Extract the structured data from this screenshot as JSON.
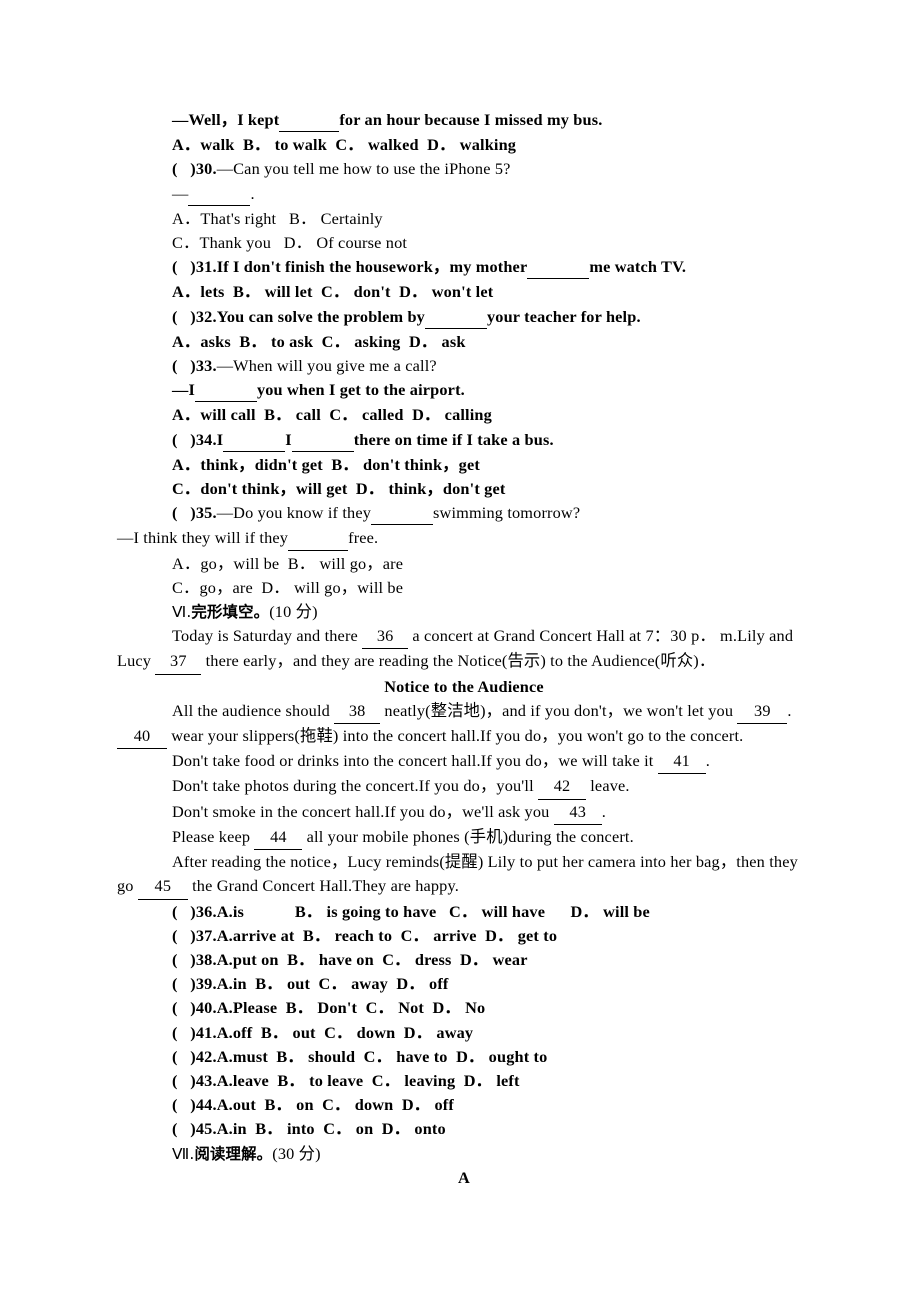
{
  "document": {
    "type": "english-exam-worksheet",
    "page_background": "#ffffff",
    "text_color": "#000000"
  },
  "lines": {
    "q29_stem": "—Well，I kept",
    "q29_stem_tail": "for an hour because I missed my bus.",
    "q29_options": "A．walk  B． to walk  C． walked  D． walking",
    "q30_head": "(   )30.",
    "q30_stem": "—Can you tell me how to use the iPhone 5?",
    "q30_answer_prefix": "—",
    "q30_answer_tail": ".",
    "q30_optionsAB": "A．That's right   B． Certainly",
    "q30_optionsCD": "C．Thank you   D． Of course not",
    "q31_head": "(   )31.",
    "q31_stem_a": "If I don't finish the housework，my mother",
    "q31_stem_b": "me watch TV.",
    "q31_options": "A．lets  B． will let  C． don't  D． won't let",
    "q32_head": "(   )32.",
    "q32_stem_a": "You can solve the problem by",
    "q32_stem_b": "your teacher for help.",
    "q32_options": "A．asks  B． to ask  C． asking  D． ask",
    "q33_head": "(   )33.",
    "q33_stem": "—When will you give me a call?",
    "q33_answer_prefix": "—I",
    "q33_answer_tail": "you when I get to the airport.",
    "q33_options": "A．will call  B． call  C． called  D． calling",
    "q34_head": "(   )34.",
    "q34_stem_a": "I",
    "q34_stem_b": "I",
    "q34_stem_c": "there on time if I take a bus.",
    "q34_optionsAB": "A．think，didn't get  B． don't think，get",
    "q34_optionsCD": "C．don't think，will get  D． think，don't get",
    "q35_head": "(   )35.",
    "q35_stem_a": "—Do you know if they",
    "q35_stem_b": "swimming tomorrow?",
    "q35_answer_a": "—I think they will if they",
    "q35_answer_b": "free.",
    "q35_optionsAB": "A．go，will be  B． will go，are",
    "q35_optionsCD": "C．go，are  D． will go，will be"
  },
  "section_cloze": {
    "heading_roman": "Ⅵ.",
    "heading_cjk": "完形填空。",
    "heading_points": "(10 分)",
    "intro_line1_a": "Today is Saturday and there ",
    "intro_blank1": "36",
    "intro_line1_b": " a concert at Grand Concert Hall at 7：30 p． m.Lily and",
    "intro_line2_a": "Lucy ",
    "intro_blank2": "37",
    "intro_line2_b": " there early，and they are reading the Notice(告示) to the Audience(听众)．",
    "notice_title": "Notice to the Audience",
    "notice_lines": [
      {
        "a": "All the audience should ",
        "blank": "38",
        "b": " neatly(整洁地)，and if you don't，we won't let you ",
        "blank2": "39",
        "c": "."
      },
      {
        "a": "",
        "blank": "40",
        "b": " wear your slippers(拖鞋) into the concert hall.If you do，you won't go to the concert.",
        "blank2": "",
        "c": ""
      },
      {
        "a": "Don't take food or drinks into the concert hall.If you do，we will take it ",
        "blank": "41",
        "b": ".",
        "blank2": "",
        "c": ""
      },
      {
        "a": "Don't take photos during the concert.If you do，you'll ",
        "blank": "42",
        "b": " leave.",
        "blank2": "",
        "c": ""
      },
      {
        "a": "Don't smoke in the concert hall.If you do，we'll ask you ",
        "blank": "43",
        "b": ".",
        "blank2": "",
        "c": ""
      },
      {
        "a": "Please keep ",
        "blank": "44",
        "b": " all your mobile phones (手机)during the concert.",
        "blank2": "",
        "c": ""
      }
    ],
    "closing_line1": "After reading the notice，Lucy reminds(提醒) Lily to put her camera into her bag，then they",
    "closing_line2_a": "go ",
    "closing_blank": "45",
    "closing_line2_b": " the Grand Concert Hall.They are happy.",
    "questions": [
      {
        "head": "(   )36.",
        "opts": "A.is            B． is going to have   C． will have      D． will be"
      },
      {
        "head": "(   )37.",
        "opts": "A.arrive at  B． reach to  C． arrive  D． get to"
      },
      {
        "head": "(   )38.",
        "opts": "A.put on  B． have on  C． dress  D． wear"
      },
      {
        "head": "(   )39.",
        "opts": "A.in  B． out  C． away  D． off"
      },
      {
        "head": "(   )40.",
        "opts": "A.Please  B． Don't  C． Not  D． No"
      },
      {
        "head": "(   )41.",
        "opts": "A.off  B． out  C． down  D． away"
      },
      {
        "head": "(   )42.",
        "opts": "A.must  B． should  C． have to  D． ought to"
      },
      {
        "head": "(   )43.",
        "opts": "A.leave  B． to leave  C． leaving  D． left"
      },
      {
        "head": "(   )44.",
        "opts": "A.out  B． on  C． down  D． off"
      },
      {
        "head": "(   )45.",
        "opts": "A.in  B． into  C． on  D． onto"
      }
    ]
  },
  "section_reading": {
    "heading_roman": "Ⅶ.",
    "heading_cjk": "阅读理解。",
    "heading_points": "(30 分)",
    "passage_label": "A"
  }
}
